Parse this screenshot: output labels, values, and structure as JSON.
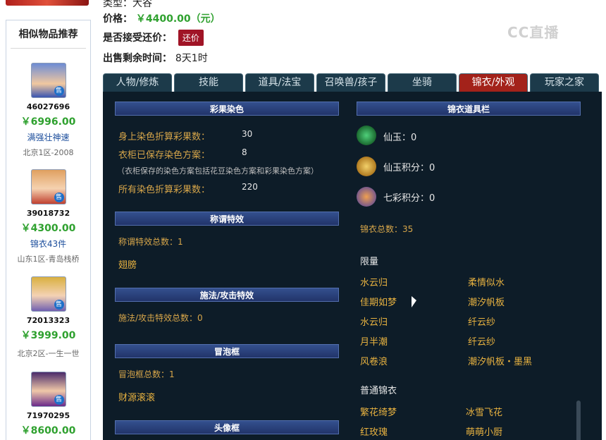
{
  "header": {
    "price_label": "价格：",
    "price_value": "￥4400.00（元）",
    "bargain_label": "是否接受还价：",
    "bargain_button": "还价",
    "remaining_label": "出售剩余时间：",
    "remaining_value": "8天1时",
    "top_cut_text": "类型：大谷"
  },
  "watermark": "CC直播",
  "sidebar": {
    "title": "相似物品推荐",
    "items": [
      {
        "id": "46027696",
        "price": "￥6996.00",
        "tag": "满强壮神速",
        "server": "北京1区-2008"
      },
      {
        "id": "39018732",
        "price": "￥4300.00",
        "tag": "锦衣43件",
        "server": "山东1区-青岛栈桥"
      },
      {
        "id": "72013323",
        "price": "￥3999.00",
        "tag": "",
        "server": "北京2区-一生一世"
      },
      {
        "id": "71970295",
        "price": "￥8600.00",
        "tag": "",
        "server": ""
      }
    ],
    "sale_badge": "售"
  },
  "tabs": [
    "人物/修炼",
    "技能",
    "道具/法宝",
    "召唤兽/孩子",
    "坐骑",
    "锦衣/外观",
    "玩家之家"
  ],
  "active_tab": "锦衣/外观",
  "left": {
    "dye_header": "彩果染色",
    "dye_rows": [
      {
        "label": "身上染色折算彩果数：",
        "value": "30"
      },
      {
        "label": "衣柜已保存染色方案：",
        "value": "8"
      }
    ],
    "dye_note": "（衣柜保存的染色方案包括花豆染色方案和彩果染色方案）",
    "dye_all": {
      "label": "所有染色折算彩果数：",
      "value": "220"
    },
    "title_header": "称谓特效",
    "title_total": "称谓特效总数：1",
    "title_item": "翅膀",
    "cast_header": "施法/攻击特效",
    "cast_total": "施法/攻击特效总数：0",
    "bubble_header": "冒泡框",
    "bubble_total": "冒泡框总数：1",
    "bubble_item": "财源滚滚",
    "avatar_header": "头像框"
  },
  "right": {
    "header": "锦衣道具栏",
    "props": [
      {
        "name": "仙玉：0",
        "icon": "jade-icon"
      },
      {
        "name": "仙玉积分：0",
        "icon": "jade-points-icon"
      },
      {
        "name": "七彩积分：0",
        "icon": "rainbow-points-icon"
      }
    ],
    "total": "锦衣总数：35",
    "limited_title": "限量",
    "limited": [
      [
        "水云归",
        "柔情似水"
      ],
      [
        "佳期如梦",
        "潮汐帆板"
      ],
      [
        "水云归",
        "纤云纱"
      ],
      [
        "月半潮",
        "纤云纱"
      ],
      [
        "风卷浪",
        "潮汐帆板・墨黑"
      ]
    ],
    "normal_title": "普通锦衣",
    "normal": [
      [
        "繁花绮梦",
        "冰雪飞花"
      ],
      [
        "红玫瑰",
        "萌萌小厨"
      ]
    ]
  }
}
